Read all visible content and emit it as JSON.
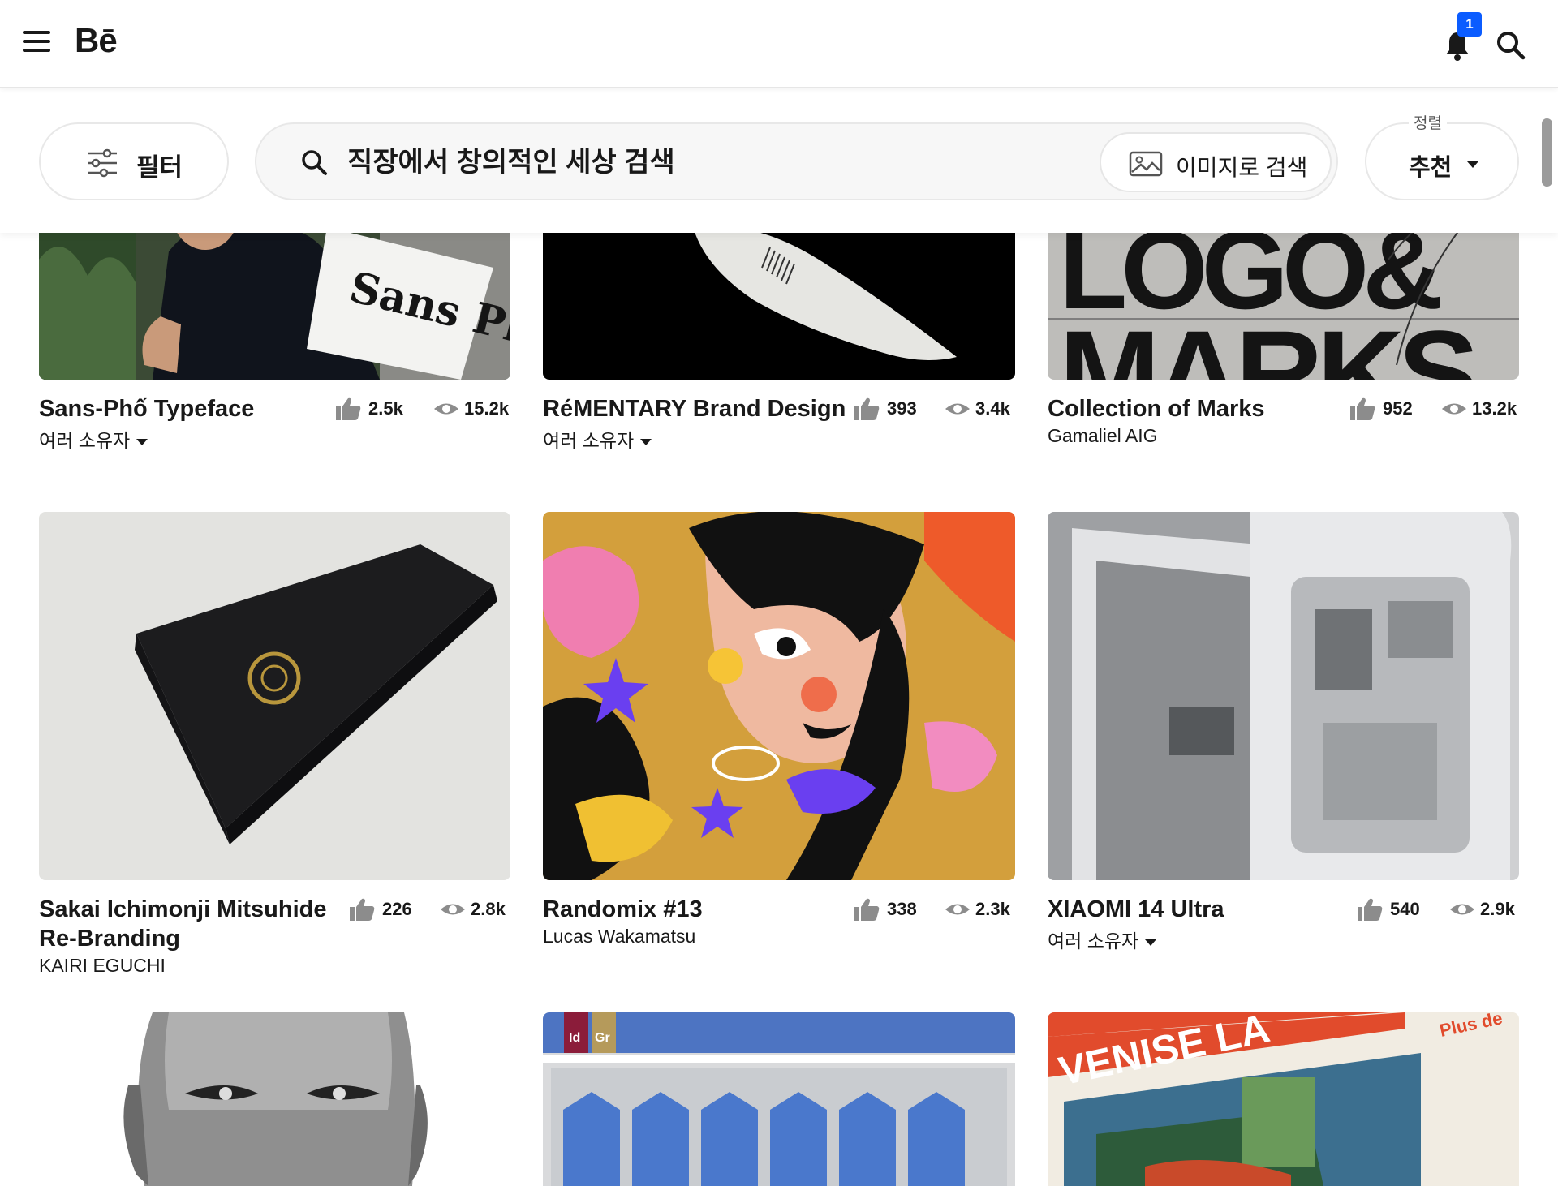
{
  "header": {
    "logo": "Bē",
    "notification_count": "1"
  },
  "filters": {
    "filter_label": "필터",
    "search_placeholder": "직장에서 창의적인 세상 검색",
    "search_value": "",
    "image_search_label": "이미지로 검색",
    "sort_caption": "정렬",
    "sort_value": "추천"
  },
  "projects": [
    {
      "title": "Sans-Phố Typeface",
      "owner": "여러 소유자",
      "likes": "2.5k",
      "views": "15.2k"
    },
    {
      "title": "RéMENTARY Brand Design",
      "owner": "여러 소유자",
      "likes": "393",
      "views": "3.4k"
    },
    {
      "title": "Collection of Marks",
      "owner": "Gamaliel AIG",
      "likes": "952",
      "views": "13.2k"
    },
    {
      "title_line1": "Sakai Ichimonji Mitsuhide",
      "title_line2": "Re-Branding",
      "owner": "KAIRI EGUCHI",
      "likes": "226",
      "views": "2.8k"
    },
    {
      "title": "Randomix #13",
      "owner": "Lucas Wakamatsu",
      "likes": "338",
      "views": "2.3k"
    },
    {
      "title": "XIAOMI 14 Ultra",
      "owner": "여러 소유자",
      "likes": "540",
      "views": "2.9k"
    }
  ],
  "thumbnail_text": {
    "logo_marks_line1": "LOGO&",
    "logo_marks_line2": "MARKS",
    "sign_text": "Sans Phố",
    "poster_text": "VENISE LA",
    "menu_text": "Plus de",
    "badge_id": "Id",
    "badge_gr": "Gr"
  },
  "icons": [
    "menu-icon",
    "bell-icon",
    "search-icon",
    "filter-sliders-icon",
    "image-icon",
    "thumbs-up-icon",
    "eye-icon"
  ],
  "colors": {
    "accent": "#0b5cff",
    "text": "#191919",
    "border": "#e8e8e8"
  }
}
